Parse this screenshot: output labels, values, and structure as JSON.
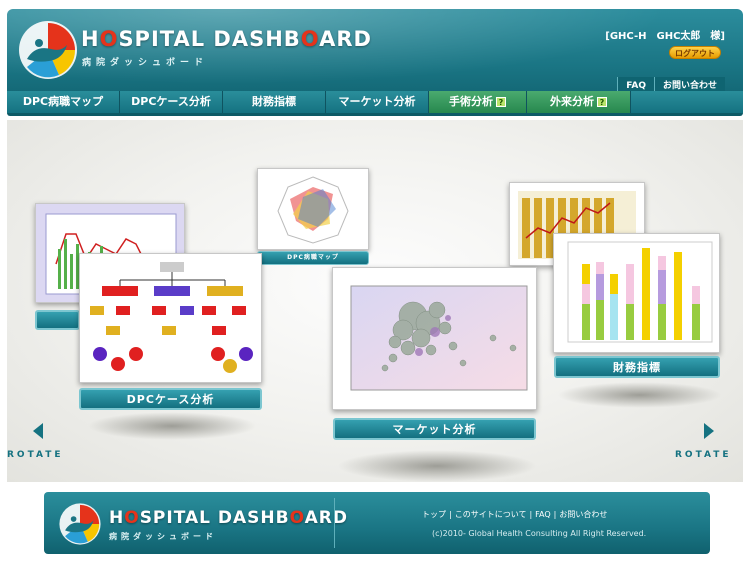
{
  "app": {
    "logo_title_pre": "H",
    "logo_title_o": "O",
    "logo_title_mid": "SPITAL DASHB",
    "logo_title_o2": "O",
    "logo_title_post": "ARD",
    "logo_subtitle": "病院ダッシュボード"
  },
  "user": {
    "name": "[GHC-H　GHC太郎　様]",
    "logout_label": "ログアウト"
  },
  "utility_nav": [
    "FAQ",
    "お問い合わせ"
  ],
  "main_nav": [
    {
      "label": "DPC病職マップ",
      "badge": ""
    },
    {
      "label": "DPCケース分析",
      "badge": ""
    },
    {
      "label": "財務指標",
      "badge": ""
    },
    {
      "label": "マーケット分析",
      "badge": ""
    },
    {
      "label": "手術分析",
      "badge": "?"
    },
    {
      "label": "外来分析",
      "badge": "?"
    }
  ],
  "carousel": {
    "cards": [
      {
        "label": "DPCケース分析"
      },
      {
        "label": "マーケット分析"
      },
      {
        "label": "財務指標"
      },
      {
        "label": "DPC病職マップ"
      }
    ],
    "rotate_left": "ROTATE",
    "rotate_right": "ROTATE"
  },
  "footer": {
    "links": [
      "トップ",
      "このサイトについて",
      "FAQ",
      "お問い合わせ"
    ],
    "copyright": "(c)2010- Global Health Consulting All Right Reserved."
  },
  "colors": {
    "teal": "#1a7584",
    "red_o": "#e5331b",
    "logout": "#e69b00",
    "green_tab": "#27884e"
  }
}
